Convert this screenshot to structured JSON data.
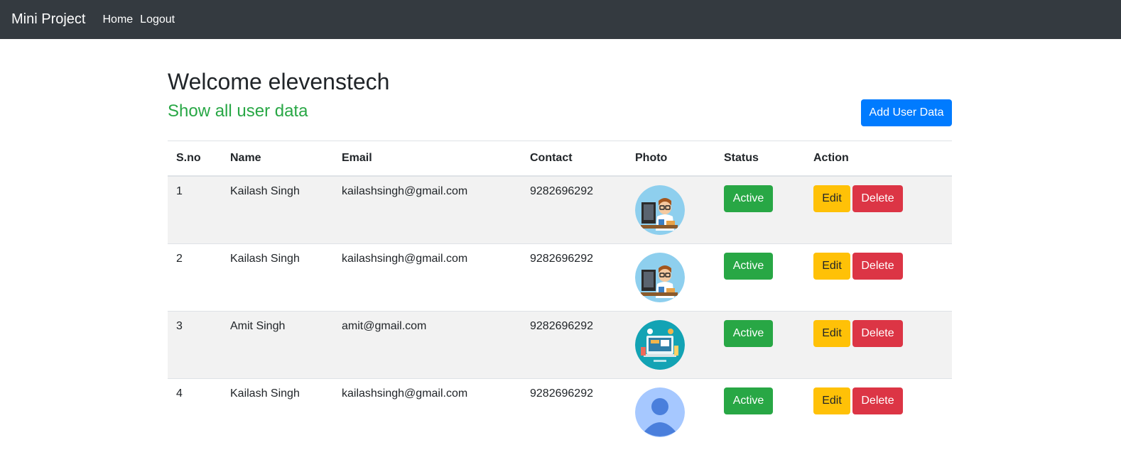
{
  "navbar": {
    "brand": "Mini Project",
    "links": [
      {
        "label": "Home"
      },
      {
        "label": "Logout"
      }
    ]
  },
  "header": {
    "title": "Welcome elevenstech",
    "subtitle": "Show all user data",
    "add_button": "Add User Data"
  },
  "colors": {
    "navbar_bg": "#343a40",
    "primary": "#007bff",
    "success": "#28a745",
    "warning": "#ffc107",
    "danger": "#dc3545"
  },
  "table": {
    "headers": [
      "S.no",
      "Name",
      "Email",
      "Contact",
      "Photo",
      "Status",
      "Action"
    ],
    "rows": [
      {
        "sno": "1",
        "name": "Kailash Singh",
        "email": "kailashsingh@gmail.com",
        "contact": "9282696292",
        "photo": "developer-avatar",
        "status": "Active",
        "edit": "Edit",
        "delete": "Delete"
      },
      {
        "sno": "2",
        "name": "Kailash Singh",
        "email": "kailashsingh@gmail.com",
        "contact": "9282696292",
        "photo": "developer-avatar",
        "status": "Active",
        "edit": "Edit",
        "delete": "Delete"
      },
      {
        "sno": "3",
        "name": "Amit Singh",
        "email": "amit@gmail.com",
        "contact": "9282696292",
        "photo": "teal-workspace-illustration",
        "status": "Active",
        "edit": "Edit",
        "delete": "Delete"
      },
      {
        "sno": "4",
        "name": "Kailash Singh",
        "email": "kailashsingh@gmail.com",
        "contact": "9282696292",
        "photo": "default-user-avatar",
        "status": "Active",
        "edit": "Edit",
        "delete": "Delete"
      }
    ]
  }
}
